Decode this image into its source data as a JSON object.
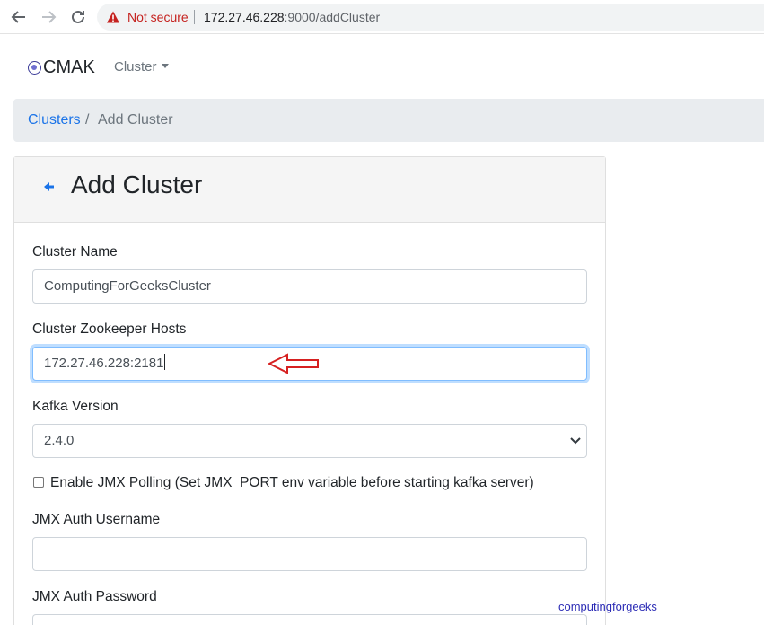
{
  "browser": {
    "security_label": "Not secure",
    "url_host": "172.27.46.228",
    "url_path": ":9000/addCluster"
  },
  "navbar": {
    "brand": "CMAK",
    "cluster_menu": "Cluster"
  },
  "breadcrumb": {
    "link": "Clusters",
    "separator": "/",
    "active": "Add Cluster"
  },
  "form": {
    "title": "Add Cluster",
    "cluster_name": {
      "label": "Cluster Name",
      "value": "ComputingForGeeksCluster"
    },
    "zk_hosts": {
      "label": "Cluster Zookeeper Hosts",
      "value": "172.27.46.228:2181"
    },
    "kafka_version": {
      "label": "Kafka Version",
      "value": "2.4.0"
    },
    "jmx_polling": {
      "label": "Enable JMX Polling (Set JMX_PORT env variable before starting kafka server)",
      "checked": false
    },
    "jmx_username": {
      "label": "JMX Auth Username",
      "value": ""
    },
    "jmx_password": {
      "label": "JMX Auth Password",
      "value": ""
    }
  },
  "watermark": "computingforgeeks",
  "icons": {
    "back": "arrow-left-icon",
    "forward": "arrow-right-icon",
    "reload": "reload-icon",
    "warning": "warning-triangle-icon",
    "brand": "cmak-logo-icon",
    "page_back": "back-arrow-icon",
    "annotation": "red-arrow-icon"
  },
  "colors": {
    "accent": "#1a73e8",
    "warning": "#c5221f",
    "annotation": "#d62020",
    "watermark": "#2b2bb5"
  }
}
